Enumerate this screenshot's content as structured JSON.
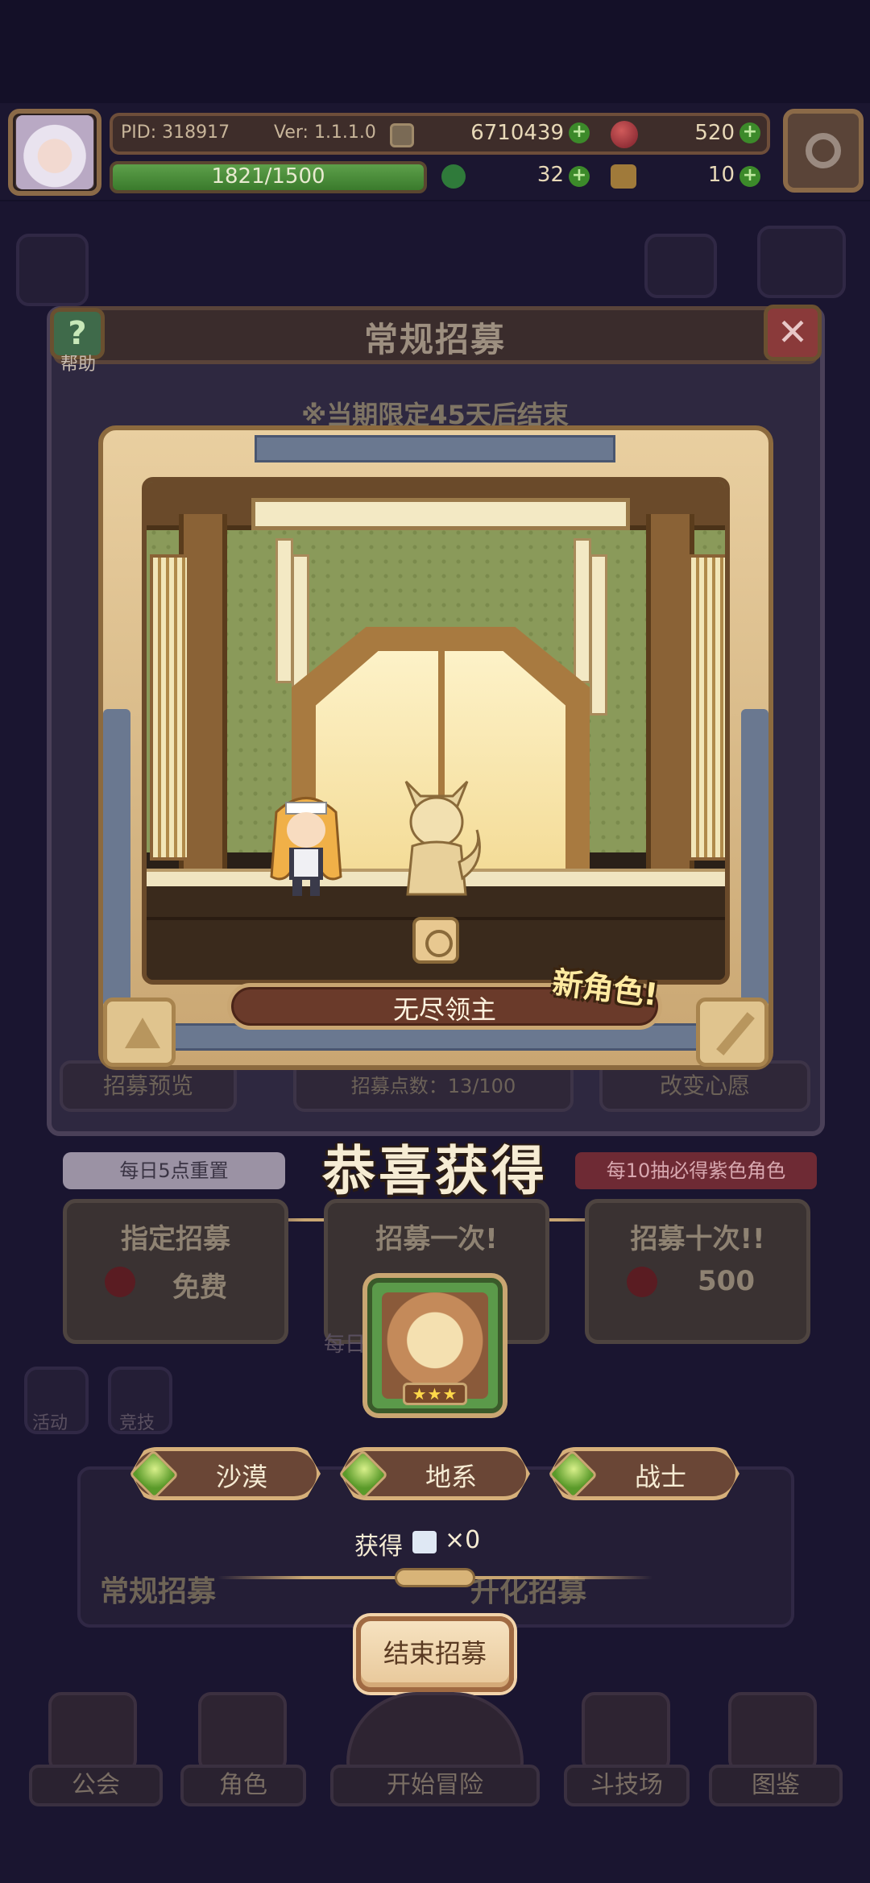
{
  "hud": {
    "pid": "PID: 318917",
    "version": "Ver: 1.1.1.0",
    "gold": "6710439",
    "gems": "520",
    "exp": "1821/1500",
    "clover": "32",
    "keys": "10",
    "plus": "+"
  },
  "window": {
    "title": "常规招募",
    "help": "帮助",
    "close": "✕",
    "notice": "※当期限定45天后结束",
    "tabs": [
      "招募预览",
      "招募点数：13/100",
      "改变心愿"
    ],
    "reset_tag": "每日5点重置",
    "purple_tag": "每10抽必得紫色角色",
    "options": [
      {
        "title": "指定招募",
        "price": "免费"
      },
      {
        "title": "招募一次!",
        "price": ""
      },
      {
        "title": "招募十次!!",
        "price": "500"
      }
    ],
    "daily_limit": "每日…999",
    "banners": [
      "常规招募",
      "升化招募"
    ]
  },
  "card": {
    "character_name": "无尽领主",
    "new_badge": "新角色!"
  },
  "result": {
    "congrats": "恭喜获得",
    "stars": "★★★",
    "tags": [
      "沙漠",
      "地系",
      "战士"
    ],
    "obtain_label": "获得",
    "obtain_mult": "×0",
    "end_button": "结束招募"
  },
  "nav": {
    "items": [
      "公会",
      "角色",
      "开始冒险",
      "斗技场",
      "图鉴"
    ],
    "side_items": [
      "活动",
      "竞技"
    ]
  },
  "colors": {
    "exp_fill": "#5da04a",
    "tag_gem": "#8cc63f",
    "accent_gold": "#c9a672"
  },
  "exp_fraction": 1.0
}
